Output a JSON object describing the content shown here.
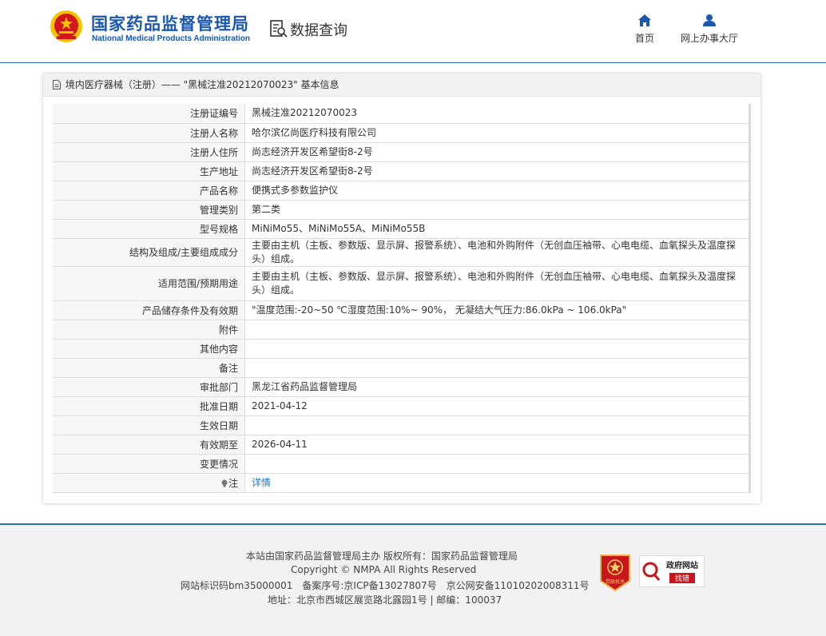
{
  "header": {
    "title": "国家药品监督管理局",
    "subtitle": "National Medical Products Administration",
    "query_title": "数据查询",
    "nav": [
      {
        "label": "首页",
        "icon": "home-icon"
      },
      {
        "label": "网上办事大厅",
        "icon": "user-icon"
      }
    ]
  },
  "panel": {
    "title": "境内医疗器械（注册）—— \"黑械注准20212070023\" 基本信息"
  },
  "rows": [
    {
      "k": "注册证编号",
      "v": "黑械注准20212070023"
    },
    {
      "k": "注册人名称",
      "v": "哈尔滨亿尚医疗科技有限公司"
    },
    {
      "k": "注册人住所",
      "v": "尚志经济开发区希望街8-2号"
    },
    {
      "k": "生产地址",
      "v": "尚志经济开发区希望街8-2号"
    },
    {
      "k": "产品名称",
      "v": "便携式多参数监护仪"
    },
    {
      "k": "管理类别",
      "v": "第二类"
    },
    {
      "k": "型号规格",
      "v": "MiNiMo55、MiNiMo55A、MiNiMo55B"
    },
    {
      "k": "结构及组成/主要组成成分",
      "v": "主要由主机（主板、参数版、显示屏、报警系统）、电池和外购附件（无创血压袖带、心电电缆、血氧探头及温度探头）组成。"
    },
    {
      "k": "适用范围/预期用途",
      "v": "主要由主机（主板、参数版、显示屏、报警系统）、电池和外购附件（无创血压袖带、心电电缆、血氧探头及温度探头）组成。"
    },
    {
      "k": "产品储存条件及有效期",
      "v": "\"温度范围:-20~50 ℃湿度范围:10%~ 90%， 无凝结大气压力:86.0kPa ~ 106.0kPa\""
    },
    {
      "k": "附件",
      "v": ""
    },
    {
      "k": "其他内容",
      "v": ""
    },
    {
      "k": "备注",
      "v": ""
    },
    {
      "k": "审批部门",
      "v": "黑龙江省药品监督管理局"
    },
    {
      "k": "批准日期",
      "v": "2021-04-12"
    },
    {
      "k": "生效日期",
      "v": ""
    },
    {
      "k": "有效期至",
      "v": "2026-04-11"
    },
    {
      "k": "变更情况",
      "v": ""
    },
    {
      "k": "注",
      "v": "详情"
    }
  ],
  "footer": {
    "line1": "本站由国家药品监督管理局主办 版权所有：国家药品监督管理局",
    "line2": "Copyright © NMPA All Rights Reserved",
    "line3": "网站标识码bm35000001　备案序号:京ICP备13027807号　京公网安备11010202008311号",
    "line4": "地址：北京市西城区展览路北露园1号 | 邮编：100037",
    "badge_gov_text": "党政机关",
    "badge_err_title": "政府网站",
    "badge_err_sub": "找错"
  },
  "colors": {
    "brand_blue": "#1a57b0",
    "link_blue": "#1a78c2",
    "emblem_red": "#d2161b",
    "emblem_gold": "#f5c400"
  }
}
